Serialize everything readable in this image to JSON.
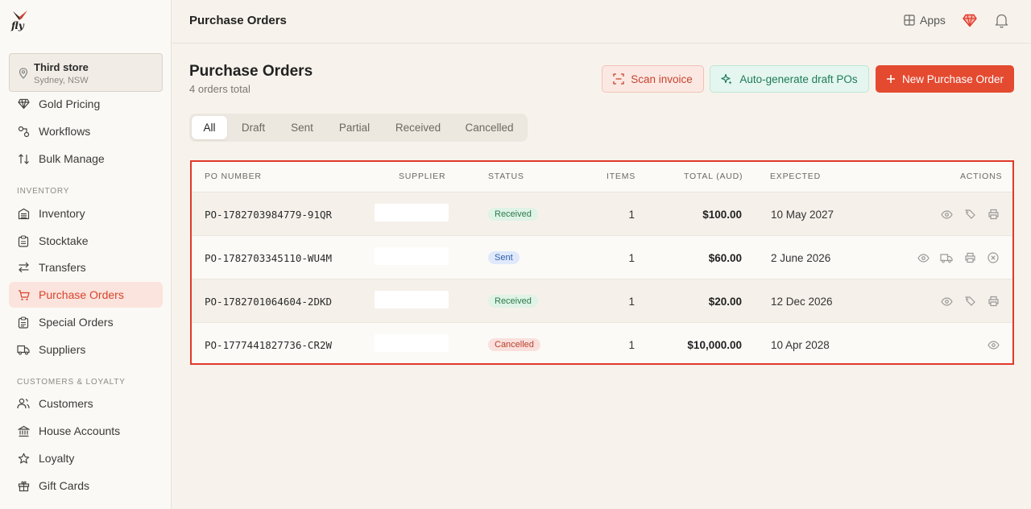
{
  "app": {
    "logo_text": "fly"
  },
  "store": {
    "name": "Third store",
    "location": "Sydney, NSW"
  },
  "sidebar": {
    "items_top": [
      {
        "label": "Gold Pricing",
        "icon": "gem-icon"
      },
      {
        "label": "Workflows",
        "icon": "workflow-icon"
      },
      {
        "label": "Bulk Manage",
        "icon": "sort-arrows-icon"
      }
    ],
    "section_inventory": "INVENTORY",
    "items_inventory": [
      {
        "label": "Inventory",
        "icon": "inventory-icon"
      },
      {
        "label": "Stocktake",
        "icon": "clipboard-icon"
      },
      {
        "label": "Transfers",
        "icon": "transfer-icon"
      },
      {
        "label": "Purchase Orders",
        "icon": "cart-icon",
        "active": true
      },
      {
        "label": "Special Orders",
        "icon": "clipboard-list-icon"
      },
      {
        "label": "Suppliers",
        "icon": "truck-icon"
      }
    ],
    "section_customers": "CUSTOMERS & LOYALTY",
    "items_customers": [
      {
        "label": "Customers",
        "icon": "users-icon"
      },
      {
        "label": "House Accounts",
        "icon": "bank-icon"
      },
      {
        "label": "Loyalty",
        "icon": "star-icon"
      },
      {
        "label": "Gift Cards",
        "icon": "gift-icon"
      }
    ]
  },
  "topbar": {
    "title": "Purchase Orders",
    "apps_label": "Apps"
  },
  "header": {
    "title": "Purchase Orders",
    "subtitle": "4 orders total",
    "scan_label": "Scan invoice",
    "auto_label": "Auto-generate draft POs",
    "new_label": "New Purchase Order"
  },
  "tabs": [
    "All",
    "Draft",
    "Sent",
    "Partial",
    "Received",
    "Cancelled"
  ],
  "table": {
    "columns": {
      "po": "PO NUMBER",
      "supplier": "SUPPLIER",
      "status": "STATUS",
      "items": "ITEMS",
      "total": "TOTAL (AUD)",
      "expected": "EXPECTED",
      "actions": "ACTIONS"
    },
    "rows": [
      {
        "po": "PO-1782703984779-91QR",
        "status": "Received",
        "items": "1",
        "total": "$100.00",
        "expected": "10 May 2027"
      },
      {
        "po": "PO-1782703345110-WU4M",
        "status": "Sent",
        "items": "1",
        "total": "$60.00",
        "expected": "2 June 2026"
      },
      {
        "po": "PO-1782701064604-2DKD",
        "status": "Received",
        "items": "1",
        "total": "$20.00",
        "expected": "12 Dec 2026"
      },
      {
        "po": "PO-1777441827736-CR2W",
        "status": "Cancelled",
        "items": "1",
        "total": "$10,000.00",
        "expected": "10 Apr 2028"
      }
    ]
  },
  "colors": {
    "accent": "#e44a30",
    "highlight_border": "#e0392a"
  }
}
